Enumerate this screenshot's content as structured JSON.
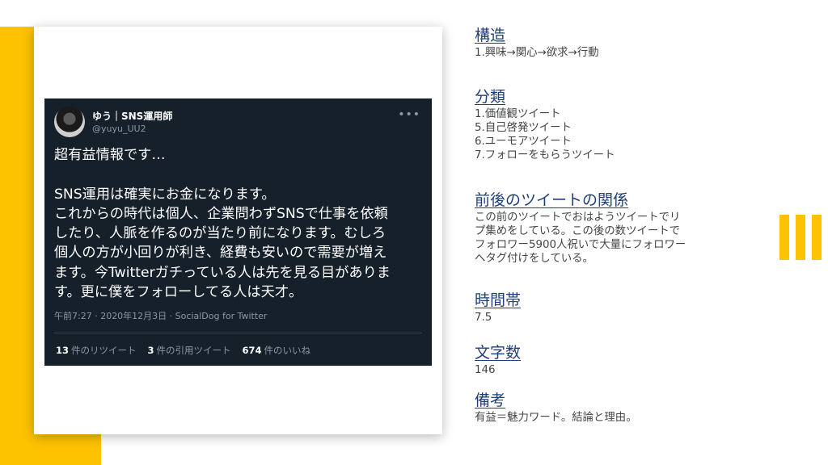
{
  "colors": {
    "accent_yellow": "#FDC200",
    "tweet_bg": "#15202B",
    "heading_blue": "#1F3F7A"
  },
  "tweet": {
    "display_name": "ゆう｜SNS運用師",
    "handle": "@yuyu_UU2",
    "more_icon": "more-dots-icon",
    "body_lines": [
      "超有益情報です…",
      "",
      "SNS運用は確実にお金になります。",
      "これからの時代は個人、企業問わずSNSで仕事を依頼",
      "したり、人脈を作るのが当たり前になります。むしろ",
      "個人の方が小回りが利き、経費も安いので需要が増え",
      "ます。今Twitterガチっている人は先を見る目がありま",
      "す。更に僕をフォローしてる人は天才。"
    ],
    "meta": "午前7:27 · 2020年12月3日 · SocialDog for Twitter",
    "stats": [
      {
        "count": "13",
        "label": "件のリツイート"
      },
      {
        "count": "3",
        "label": "件の引用ツイート"
      },
      {
        "count": "674",
        "label": "件のいいね"
      }
    ]
  },
  "notes": {
    "structure": {
      "title": "構造",
      "body": "1.興味→関心→欲求→行動"
    },
    "category": {
      "title": "分類",
      "body": "1.価値観ツイート\n5.自己啓発ツイート\n6.ユーモアツイート\n7.フォローをもらうツイート"
    },
    "relation": {
      "title": "前後のツイートの関係",
      "body": "この前のツイートでおはようツイートでリ\nプ集めをしている。この後の数ツイートで\nフォロワー5900人祝いで大量にフォロワー\nへタグ付けをしている。"
    },
    "time": {
      "title": "時間帯",
      "body": "7.5"
    },
    "chars": {
      "title": "文字数",
      "body": "146"
    },
    "remarks": {
      "title": "備考",
      "body": "有益＝魅力ワード。結論と理由。"
    }
  }
}
